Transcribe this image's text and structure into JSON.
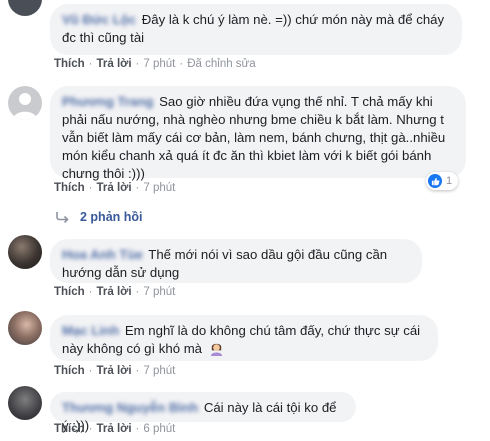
{
  "comments": [
    {
      "author": "Vũ Đức Lộc",
      "text": "Đây là k chú ý làm nè. =)) chứ món này mà để cháy đc thì cũng tài",
      "like": "Thích",
      "reply": "Trả lời",
      "time": "7 phút",
      "edited": "Đã chỉnh sửa"
    },
    {
      "author": "Phương Trang",
      "text": "Sao giờ nhiều đứa vụng thế nhỉ. T chả mấy khi phải nấu nướng, nhà nghèo nhưng bme chiều k bắt làm. Nhưng t vẫn biết làm mấy cái cơ bản, làm nem, bánh chưng, thịt gà..nhiều món kiểu chanh xả quá ít đc ăn thì kbiet làm với k biết gói bánh chưng thôi :)))",
      "like": "Thích",
      "reply": "Trả lời",
      "time": "7 phút",
      "reaction_count": "1",
      "replies_label": "2 phản hồi"
    },
    {
      "author": "Hoa Anh Tùe",
      "text": "Thế mới nói vì sao dầu gội đầu cũng cần hướng dẫn sử dụng",
      "like": "Thích",
      "reply": "Trả lời",
      "time": "7 phút"
    },
    {
      "author": "Mạc Linh",
      "text": "Em nghĩ là do không chú tâm đấy, chứ thực sự cái này không có gì khó mà",
      "emoji": "woman-shrugging-emoji",
      "like": "Thích",
      "reply": "Trả lời",
      "time": "7 phút"
    },
    {
      "author": "Thương Nguyễn Bình",
      "text": "Cái này là cái tội ko để ý :)))",
      "like": "Thích",
      "reply": "Trả lời",
      "time": "6 phút"
    }
  ]
}
